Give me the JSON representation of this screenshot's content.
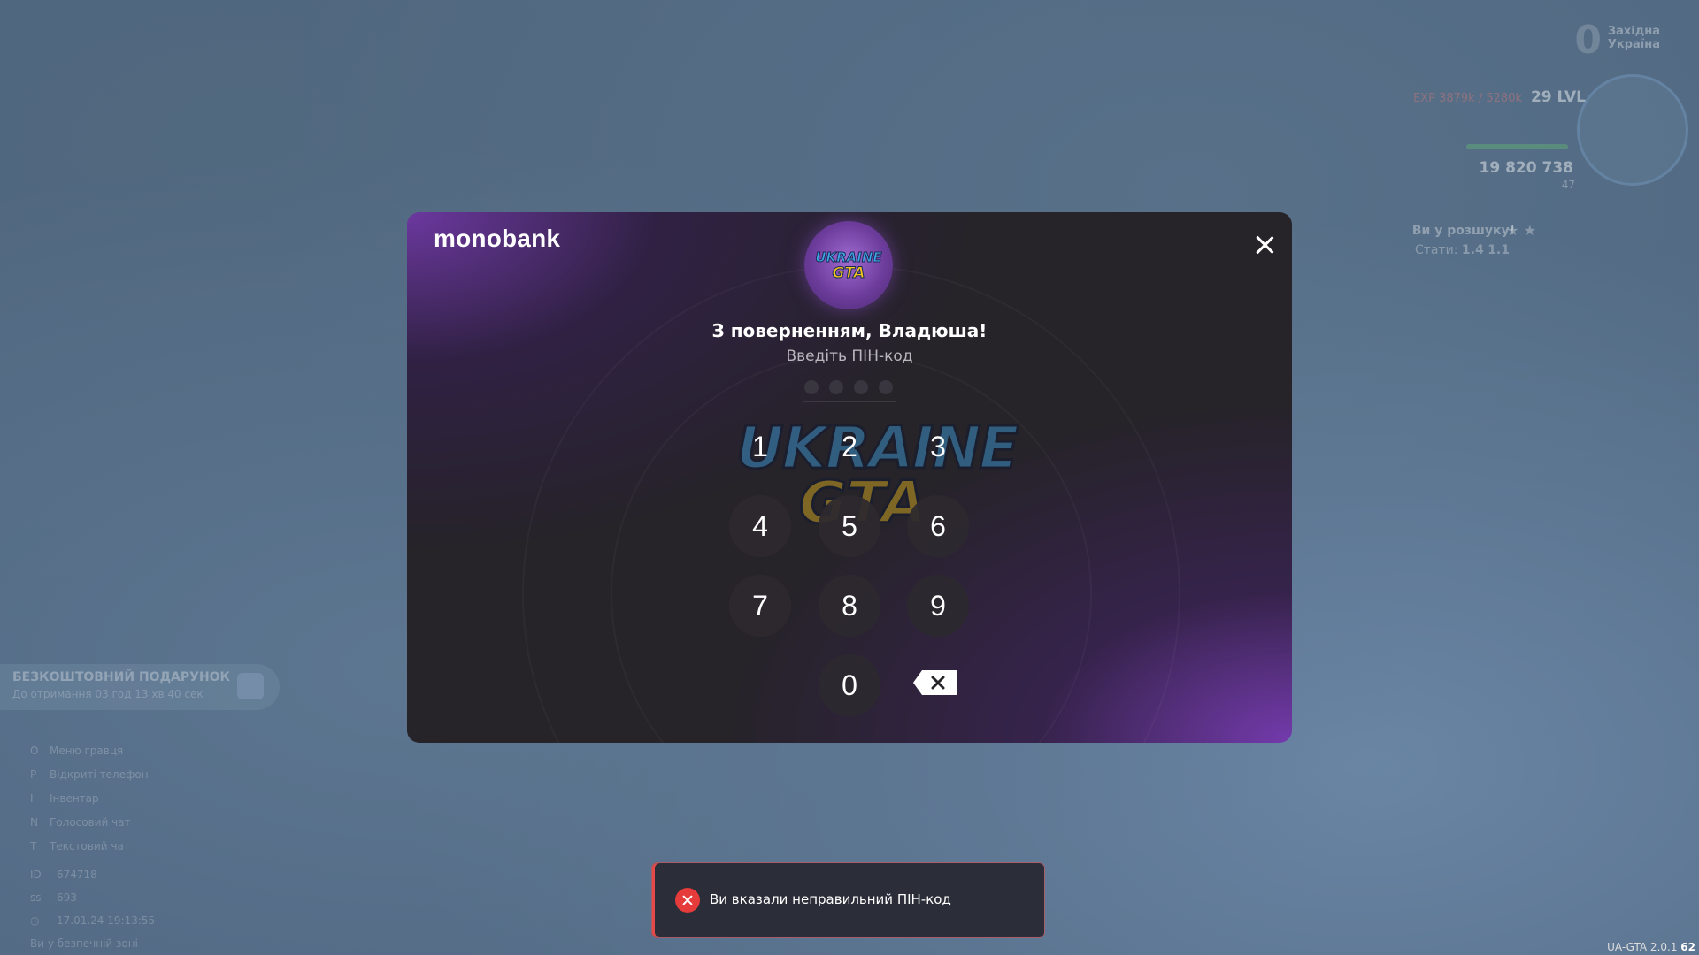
{
  "hud": {
    "region_line1": "Західна",
    "region_line2": "Україна",
    "region_zero": "0",
    "exp": "EXP 3879k / 5280k",
    "level": "29 LVL",
    "money": "19 820 738",
    "money_sub": "47",
    "wanted": "Ви у розшуку!",
    "stars": "★ ★",
    "stats_label": "Стати:",
    "stat_1": "1.4",
    "stat_2": "1.1"
  },
  "gift": {
    "title": "БЕЗКОШТОВНИЙ ПОДАРУНОК",
    "subtitle": "До отримання 03 год 13 хв 40 сек"
  },
  "menu": [
    {
      "key": "O",
      "label": "Меню гравця"
    },
    {
      "key": "P",
      "label": "Відкриті телефон"
    },
    {
      "key": "I",
      "label": "Інвентар"
    },
    {
      "key": "N",
      "label": "Голосовий чат"
    },
    {
      "key": "T",
      "label": "Текстовий чат"
    }
  ],
  "player": {
    "id_label": "ID",
    "id_value": "674718",
    "ping_label": "ss",
    "ping_value": "693",
    "datetime": "17.01.24 19:13:55",
    "zone": "Ви у безпечній зоні"
  },
  "version": {
    "text": "UA-GTA 2.0.1",
    "fps": "62"
  },
  "modal": {
    "brand": "monobank",
    "avatar_line1": "UKRAINE",
    "avatar_line2": "GTA",
    "welcome": "З поверненням, Владюша!",
    "hint": "Введіть ПІН-код",
    "pin_filled": 0,
    "pin_length": 4,
    "watermark_line1": "UKRAINE",
    "watermark_line2": "GTA",
    "keys": [
      "1",
      "2",
      "3",
      "4",
      "5",
      "6",
      "7",
      "8",
      "9",
      "0"
    ]
  },
  "toast": {
    "message": "Ви вказали неправильний ПІН-код",
    "status_color": "#e53b3b"
  },
  "colors": {
    "accent": "#7b3fbf",
    "modal_bg": "#262329"
  }
}
